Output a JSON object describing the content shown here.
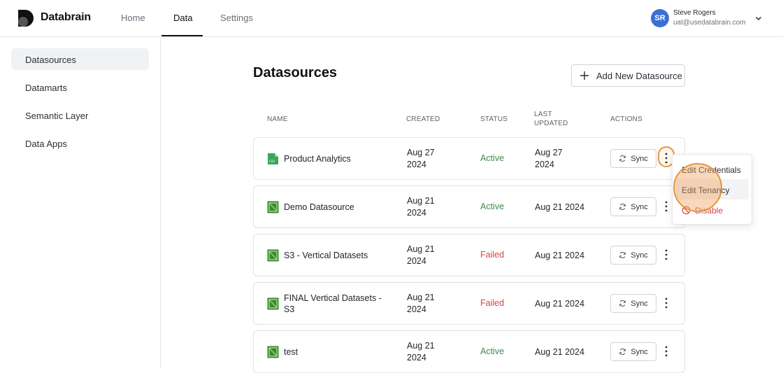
{
  "brand": {
    "name": "Databrain"
  },
  "nav": {
    "home": "Home",
    "data": "Data",
    "settings": "Settings"
  },
  "user": {
    "initials": "SR",
    "name": "Steve Rogers",
    "email": "uat@usedatabrain.com"
  },
  "sidebar": {
    "items": [
      {
        "label": "Datasources"
      },
      {
        "label": "Datamarts"
      },
      {
        "label": "Semantic Layer"
      },
      {
        "label": "Data Apps"
      }
    ]
  },
  "main": {
    "title": "Datasources",
    "add_button": "Add New Datasource",
    "columns": {
      "name": "NAME",
      "created": "CREATED",
      "status": "STATUS",
      "last_updated_line1": "LAST",
      "last_updated_line2": "UPDATED",
      "actions": "ACTIONS"
    },
    "sync_label": "Sync",
    "rows": [
      {
        "name": "Product Analytics",
        "created_line1": "Aug 27",
        "created_line2": "2024",
        "status": "Active",
        "updated_line1": "Aug 27",
        "updated_line2": "2024",
        "icon": "csv-file-icon"
      },
      {
        "name": "Demo Datasource",
        "created_line1": "Aug 21",
        "created_line2": "2024",
        "status": "Active",
        "updated": "Aug 21 2024",
        "icon": "s3-bucket-icon"
      },
      {
        "name": "S3 - Vertical Datasets",
        "created_line1": "Aug 21",
        "created_line2": "2024",
        "status": "Failed",
        "updated": "Aug 21 2024",
        "icon": "s3-bucket-icon"
      },
      {
        "name": "FINAL Vertical Datasets - S3",
        "created_line1": "Aug 21",
        "created_line2": "2024",
        "status": "Failed",
        "updated": "Aug 21 2024",
        "icon": "s3-bucket-icon"
      },
      {
        "name": "test",
        "created_line1": "Aug 21",
        "created_line2": "2024",
        "status": "Active",
        "updated": "Aug 21 2024",
        "icon": "s3-bucket-icon"
      }
    ]
  },
  "context_menu": {
    "edit_credentials": "Edit Credentials",
    "edit_tenancy": "Edit Tenancy",
    "disable": "Disable"
  },
  "colors": {
    "active": "#3f8a4a",
    "failed": "#d64545",
    "accent": "#3b6fd8",
    "highlight": "#e8943f",
    "icon_green": "#3c8a2e"
  }
}
